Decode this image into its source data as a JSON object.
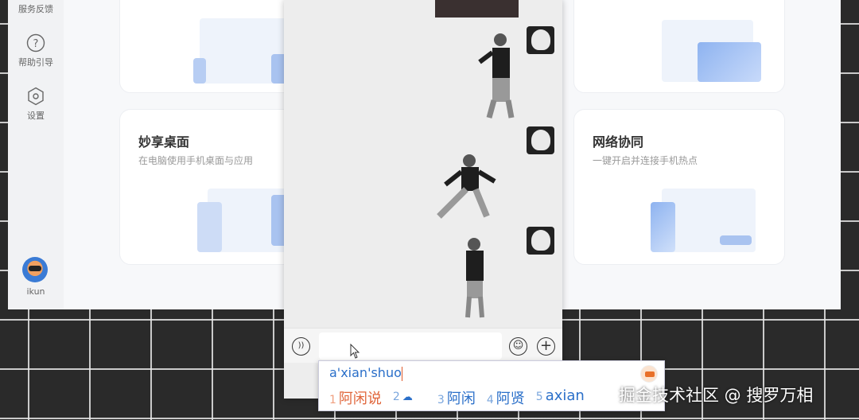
{
  "sidebar": {
    "items": [
      {
        "label": "服务反馈",
        "icon": "feedback-icon"
      },
      {
        "label": "帮助引导",
        "icon": "help-icon"
      },
      {
        "label": "设置",
        "icon": "settings-icon"
      }
    ],
    "user": {
      "name": "ikun"
    }
  },
  "cards": [
    {
      "title": "妙享桌面",
      "subtitle": "在电脑使用手机桌面与应用"
    },
    {
      "title": "网络协同",
      "subtitle": "一键开启并连接手机热点"
    }
  ],
  "chat": {
    "input_value": ""
  },
  "ime": {
    "composition": "a'xian'shuo",
    "candidates": [
      {
        "n": "1",
        "text": "阿闲说"
      },
      {
        "n": "2",
        "text": "☁"
      },
      {
        "n": "3",
        "text": "阿闲"
      },
      {
        "n": "4",
        "text": "阿贤"
      },
      {
        "n": "5",
        "text": "axian"
      }
    ]
  },
  "watermark": "掘金技术社区 @ 搜罗万相"
}
